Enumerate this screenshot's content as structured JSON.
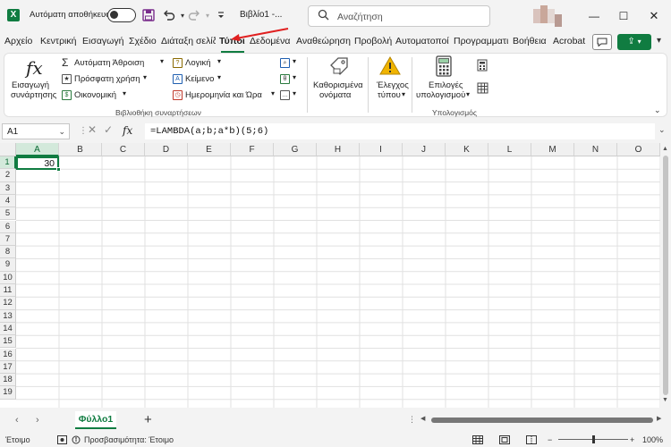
{
  "titlebar": {
    "logo_letter": "X",
    "autosave_label": "Αυτόματη αποθήκευση",
    "autosave_on": false,
    "doc_title": "Βιβλίο1 -...",
    "search_placeholder": "Αναζήτηση",
    "accent_color": "#107c41"
  },
  "tabs": [
    {
      "label": "Αρχείο",
      "active": false
    },
    {
      "label": "Κεντρική",
      "active": false
    },
    {
      "label": "Εισαγωγή",
      "active": false
    },
    {
      "label": "Σχέδιο",
      "active": false
    },
    {
      "label": "Διάταξη σελίδ",
      "active": false
    },
    {
      "label": "Τύποι",
      "active": true
    },
    {
      "label": "Δεδομένα",
      "active": false
    },
    {
      "label": "Αναθεώρηση",
      "active": false
    },
    {
      "label": "Προβολή",
      "active": false
    },
    {
      "label": "Αυτοματοποί",
      "active": false
    },
    {
      "label": "Προγραμματι",
      "active": false
    },
    {
      "label": "Βοήθεια",
      "active": false
    },
    {
      "label": "Acrobat",
      "active": false
    }
  ],
  "ribbon": {
    "insert_function": {
      "line1": "Εισαγωγή",
      "line2": "συνάρτησης"
    },
    "library": [
      {
        "label": "Αυτόματη Άθροιση",
        "icon": "sigma-icon"
      },
      {
        "label": "Πρόσφατη χρήση",
        "icon": "star-book-icon"
      },
      {
        "label": "Οικονομική",
        "icon": "finance-book-icon"
      },
      {
        "label": "Λογική",
        "icon": "logic-book-icon"
      },
      {
        "label": "Κείμενο",
        "icon": "text-book-icon"
      },
      {
        "label": "Ημερομηνία και Ώρα",
        "icon": "clock-book-icon"
      }
    ],
    "library_group_label": "Βιβλιοθήκη συναρτήσεων",
    "defined_names": {
      "line1": "Καθορισμένα",
      "line2": "ονόματα"
    },
    "formula_auditing": {
      "line1": "Έλεγχος",
      "line2": "τύπου"
    },
    "calc_options": {
      "line1": "Επιλογές",
      "line2": "υπολογισμού"
    },
    "calc_group_label": "Υπολογισμός"
  },
  "formula_bar": {
    "name_box": "A1",
    "fx": "fx",
    "formula": "=LAMBDA(a;b;a*b)(5;6)"
  },
  "grid": {
    "columns": [
      "A",
      "B",
      "C",
      "D",
      "E",
      "F",
      "G",
      "H",
      "I",
      "J",
      "K",
      "L",
      "M",
      "N",
      "O"
    ],
    "rows": [
      "1",
      "2",
      "3",
      "4",
      "5",
      "6",
      "7",
      "8",
      "9",
      "10",
      "11",
      "12",
      "13",
      "14",
      "15",
      "16",
      "17",
      "18",
      "19"
    ],
    "a1_value": "30"
  },
  "sheets": {
    "active_sheet": "Φύλλο1",
    "add_label": "+"
  },
  "status": {
    "ready": "Έτοιμο",
    "accessibility": "Προσβασιμότητα: Έτοιμο",
    "zoom": "100%"
  }
}
